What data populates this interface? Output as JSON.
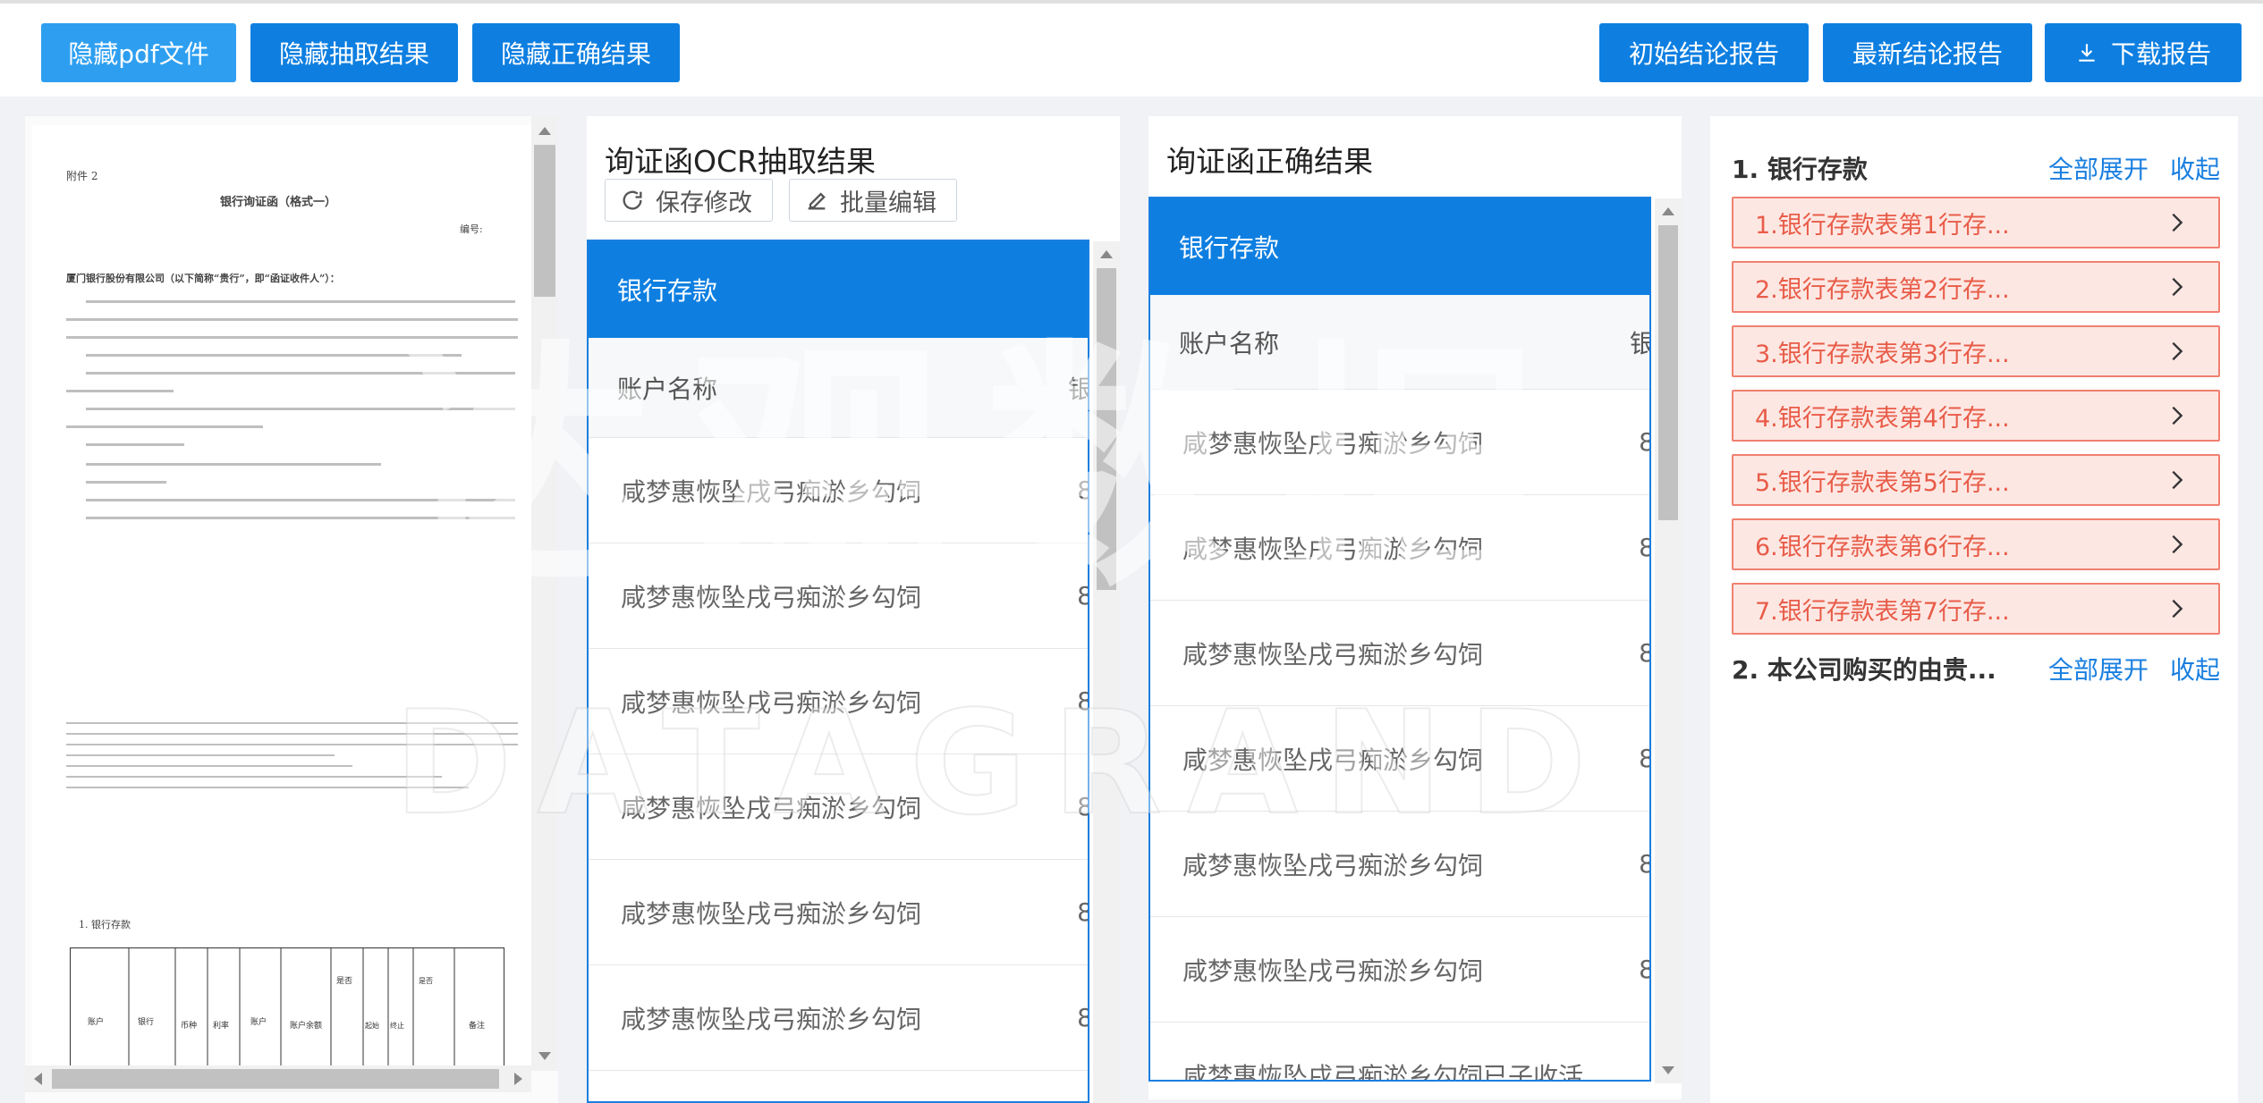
{
  "toolbar": {
    "hide_pdf": "隐藏pdf文件",
    "hide_extract": "隐藏抽取结果",
    "hide_correct": "隐藏正确结果",
    "initial_report": "初始结论报告",
    "latest_report": "最新结论报告",
    "download_report": "下载报告",
    "colors": {
      "light": "#2e9ff0",
      "dark": "#0e7fe1"
    }
  },
  "pdf": {
    "attachment": "附件 2",
    "title": "银行询证函（格式一）",
    "number": "编号:",
    "addressee": "厦门银行股份有限公司（以下简称“贵行”，即“函证收件人”）：",
    "table_section": "1. 银行存款",
    "table_headers": [
      "账户名称",
      "银行账号",
      "币种",
      "利率",
      "账户类型",
      "账户余额",
      "是否属于资金池账户",
      "起始日期",
      "终止日期",
      "是否用于担保或存在其他使用限制",
      "备注"
    ]
  },
  "ocr": {
    "title": "询证函OCR抽取结果",
    "save_label": "保存修改",
    "batch_label": "批量编辑",
    "table_header": "银行存款",
    "column_label": "账户名称",
    "clip_char": "银",
    "rows": [
      "咸梦惠恢坠戌弓痴淤乡勾饲",
      "咸梦惠恢坠戌弓痴淤乡勾饲",
      "咸梦惠恢坠戌弓痴淤乡勾饲",
      "咸梦惠恢坠戌弓痴淤乡勾饲",
      "咸梦惠恢坠戌弓痴淤乡勾饲",
      "咸梦惠恢坠戌弓痴淤乡勾饲"
    ],
    "row_clip": "8"
  },
  "correct": {
    "title": "询证函正确结果",
    "table_header": "银行存款",
    "column_label": "账户名称",
    "clip_char": "银",
    "rows": [
      "咸梦惠恢坠戌弓痴淤乡勾饲",
      "咸梦惠恢坠戌弓痴淤乡勾饲",
      "咸梦惠恢坠戌弓痴淤乡勾饲",
      "咸梦惠恢坠戌弓痴淤乡勾饲",
      "咸梦惠恢坠戌弓痴淤乡勾饲",
      "咸梦惠恢坠戌弓痴淤乡勾饲",
      "咸梦惠恢坠戌弓痴淤乡勾饲已子收活"
    ],
    "row_clip": "8"
  },
  "summary": {
    "section1": "1. 银行存款",
    "section2": "2. 本公司购买的由贵...",
    "expand_all": "全部展开",
    "collapse": "收起",
    "items": [
      "1.银行存款表第1行存...",
      "2.银行存款表第2行存...",
      "3.银行存款表第3行存...",
      "4.银行存款表第4行存...",
      "5.银行存款表第5行存...",
      "6.银行存款表第6行存...",
      "7.银行存款表第7行存..."
    ]
  },
  "watermark": {
    "cn": "达观数据",
    "en": "DATAGRAND"
  }
}
